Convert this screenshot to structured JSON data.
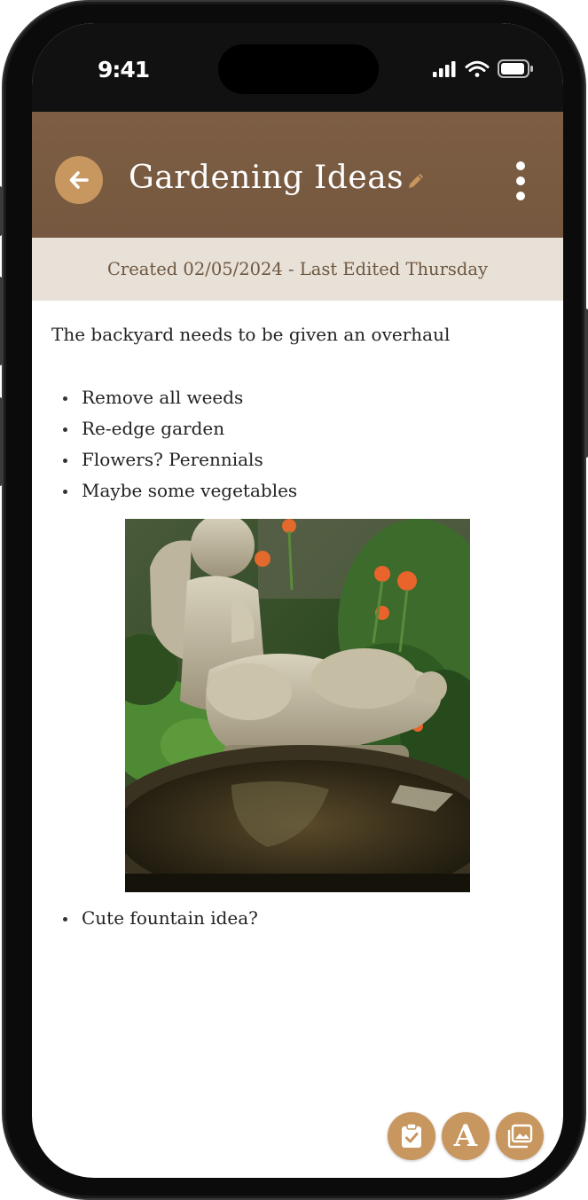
{
  "status_bar": {
    "time": "9:41"
  },
  "header": {
    "title": "Gardening Ideas",
    "back_icon": "arrow-left-icon",
    "edit_icon": "pencil-icon",
    "menu_icon": "more-vertical-icon"
  },
  "meta": {
    "text": "Created 02/05/2024 - Last Edited Thursday"
  },
  "note": {
    "intro": "The backyard needs to be given an overhaul",
    "bullets": [
      "Remove all weeds",
      "Re-edge garden",
      "Flowers? Perennials",
      "Maybe some vegetables"
    ],
    "image_icon": "garden-fountain-photo",
    "bullets_after_image": [
      "Cute fountain idea?"
    ]
  },
  "toolbar": {
    "checklist_icon": "clipboard-check-icon",
    "font_label": "A",
    "gallery_icon": "image-gallery-icon"
  },
  "colors": {
    "header": "#7a5b42",
    "accent": "#c8965f",
    "meta_bg": "#e8e1d8",
    "meta_text": "#6f5840"
  }
}
